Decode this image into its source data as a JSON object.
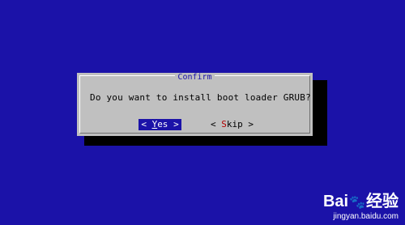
{
  "dialog": {
    "title": "Confirm",
    "message": "Do you want to install boot loader GRUB?",
    "yes_button": {
      "left": "<",
      "hotkey": "Y",
      "rest": "es",
      "right": ">"
    },
    "skip_button": {
      "left": "<",
      "hotkey": "S",
      "rest": "kip",
      "right": ">"
    }
  },
  "watermark": {
    "brand_left": "Bai",
    "brand_right": "经验",
    "url": "jingyan.baidu.com"
  },
  "colors": {
    "background": "#1b12a8",
    "dialog": "#c0c0c0",
    "selected_button": "#1b12a8",
    "hotkey": "#b00000"
  }
}
